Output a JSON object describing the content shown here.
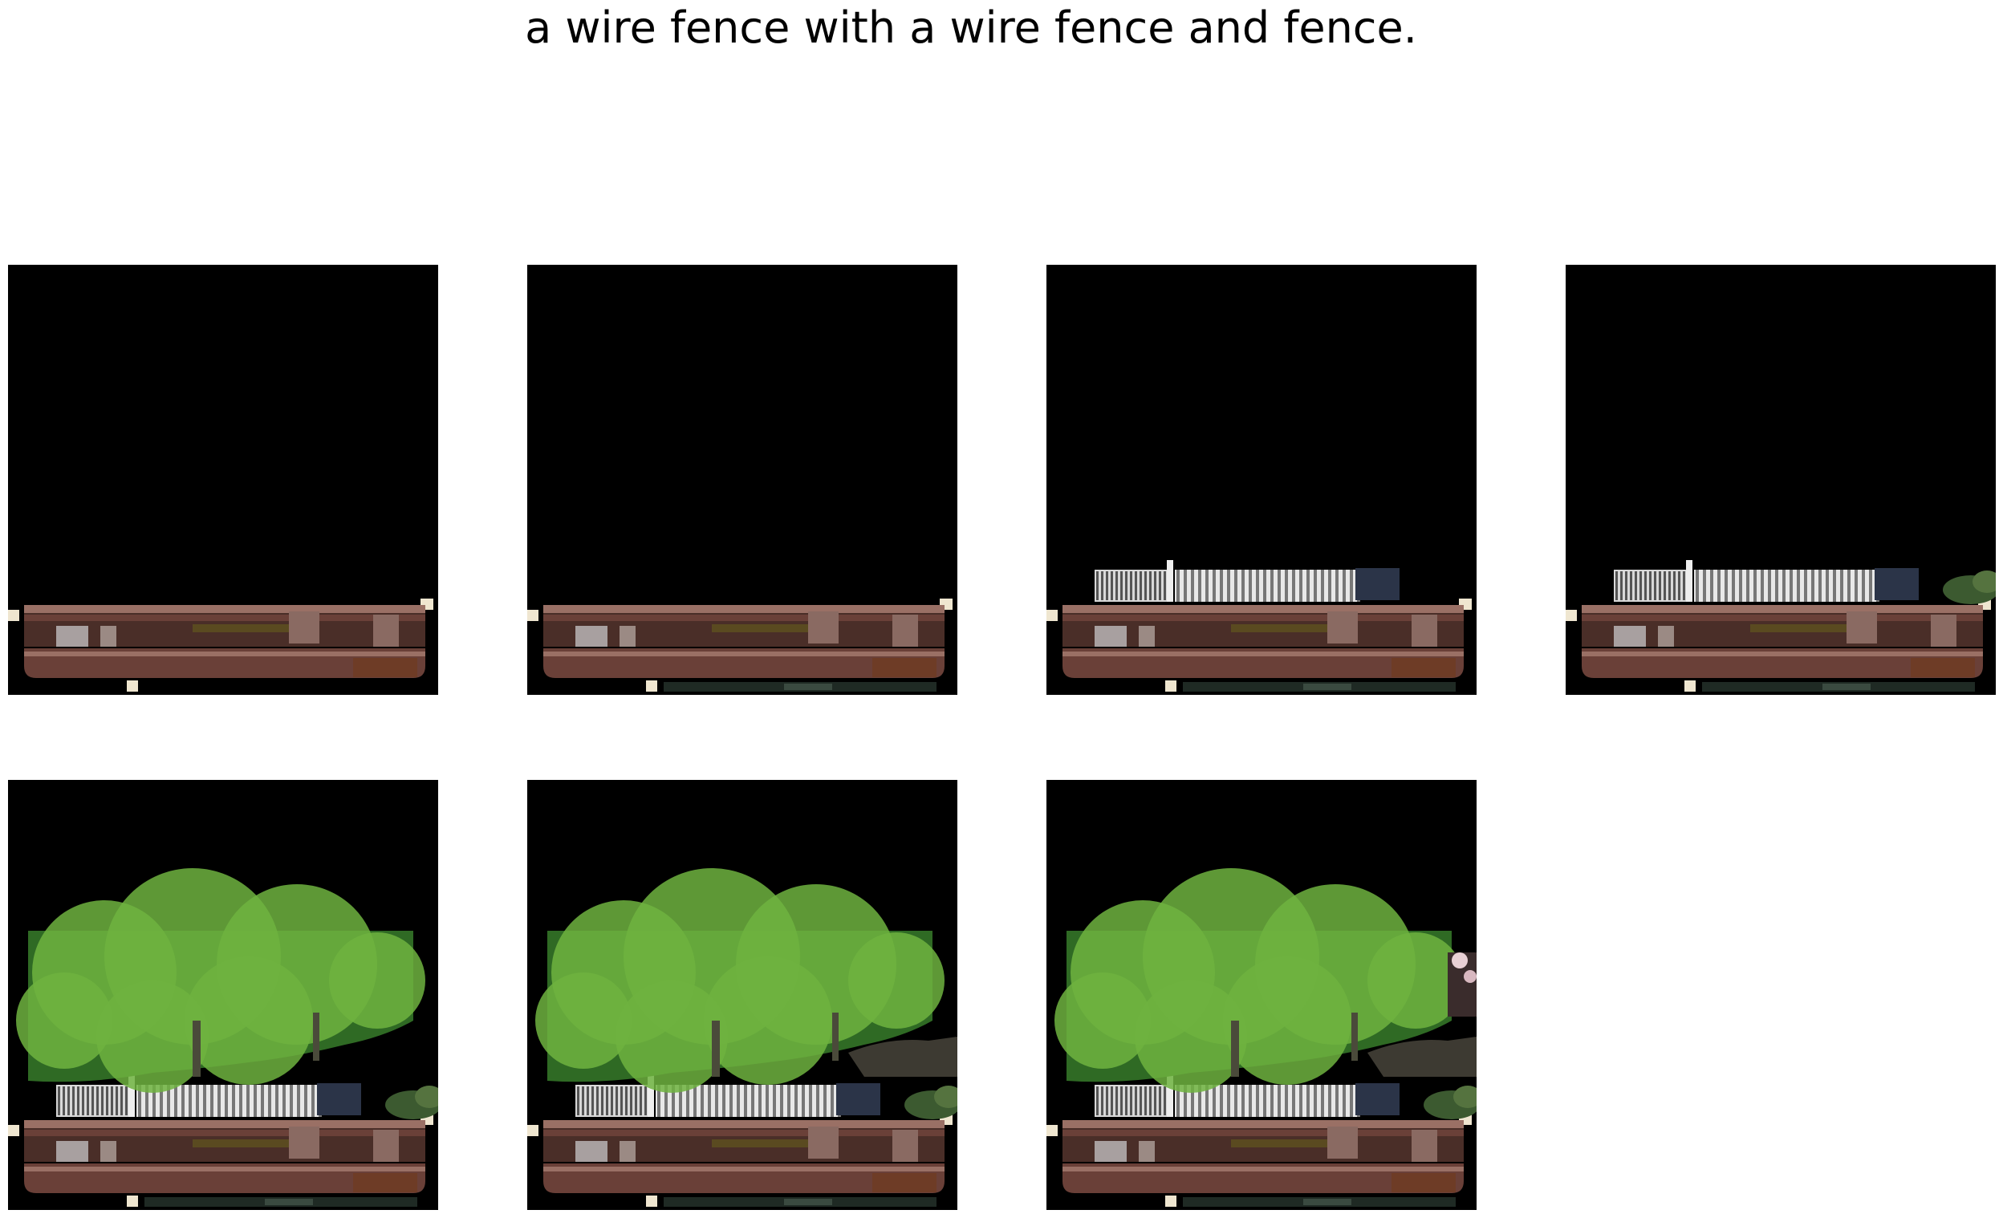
{
  "caption": "a wire fence with a wire fence and fence.",
  "panels": [
    {
      "id": "p1",
      "layers": [
        "planter-box"
      ]
    },
    {
      "id": "p2",
      "layers": [
        "planter-box",
        "ground-strip"
      ]
    },
    {
      "id": "p3",
      "layers": [
        "planter-box",
        "ground-strip",
        "white-fence"
      ]
    },
    {
      "id": "p4",
      "layers": [
        "planter-box",
        "ground-strip",
        "white-fence",
        "right-shrub"
      ]
    },
    {
      "id": "p5",
      "layers": [
        "planter-box",
        "ground-strip",
        "white-fence",
        "right-shrub",
        "green-tree"
      ]
    },
    {
      "id": "p6",
      "layers": [
        "planter-box",
        "ground-strip",
        "white-fence",
        "right-shrub",
        "green-tree",
        "dark-bush"
      ]
    },
    {
      "id": "p7",
      "layers": [
        "planter-box",
        "ground-strip",
        "white-fence",
        "right-shrub",
        "green-tree",
        "dark-bush",
        "blossom-patch"
      ]
    }
  ],
  "colors": {
    "background": "#000000",
    "wood": "#6a4038",
    "wood_light": "#9a7065",
    "foliage": "#6fb33f",
    "foliage_dark": "#2f6a24",
    "fence": "#e8e8e8"
  }
}
